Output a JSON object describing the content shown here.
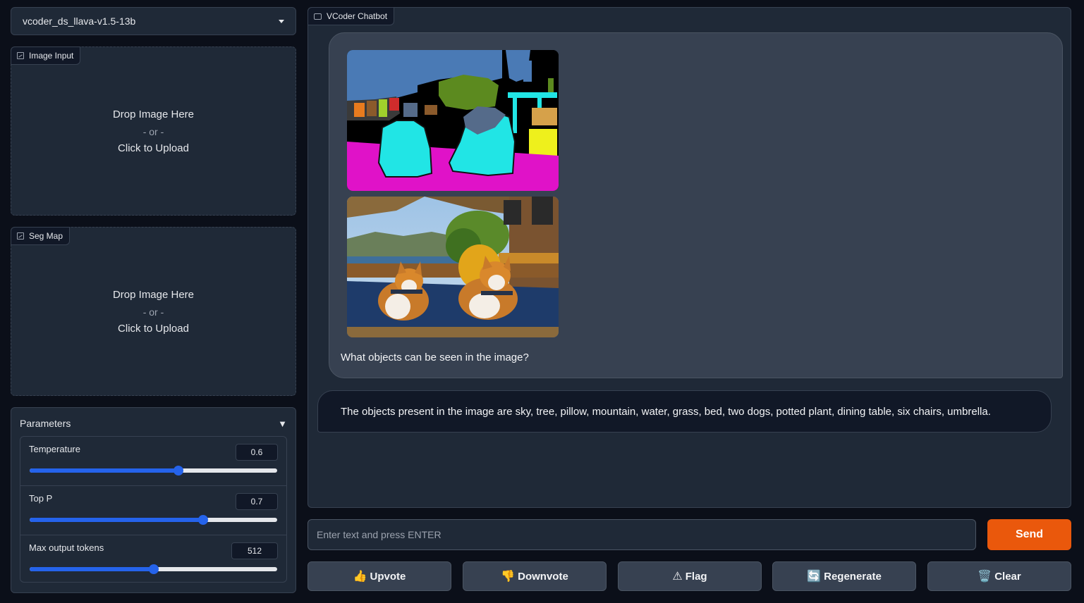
{
  "model_select": {
    "value": "vcoder_ds_llava-v1.5-13b"
  },
  "image_input": {
    "label": "Image Input",
    "drop_text": "Drop Image Here",
    "or_text": "- or -",
    "click_text": "Click to Upload"
  },
  "seg_map": {
    "label": "Seg Map",
    "drop_text": "Drop Image Here",
    "or_text": "- or -",
    "click_text": "Click to Upload"
  },
  "parameters": {
    "title": "Parameters",
    "toggle_icon": "▼",
    "temperature": {
      "label": "Temperature",
      "value": "0.6",
      "min": 0,
      "max": 1
    },
    "top_p": {
      "label": "Top P",
      "value": "0.7",
      "min": 0,
      "max": 1
    },
    "max_tokens": {
      "label": "Max output tokens",
      "value": "512",
      "min": 0,
      "max": 1024
    }
  },
  "chatbot": {
    "label": "VCoder Chatbot",
    "user_message": "What objects can be seen in the image?",
    "bot_message": "The objects present in the image are sky, tree, pillow, mountain, water, grass, bed, two dogs, potted plant, dining table, six chairs, umbrella."
  },
  "input": {
    "placeholder": "Enter text and press ENTER"
  },
  "buttons": {
    "send": "Send",
    "upvote": "Upvote",
    "upvote_icon": "👍",
    "downvote": "Downvote",
    "downvote_icon": "👎",
    "flag": "Flag",
    "flag_icon": "⚠",
    "regenerate": "Regenerate",
    "regenerate_icon": "🔄",
    "clear": "Clear",
    "clear_icon": "🗑️"
  },
  "colors": {
    "accent": "#ea580c",
    "slider": "#2563eb",
    "background": "#0b0f19",
    "panel": "#1f2937"
  }
}
